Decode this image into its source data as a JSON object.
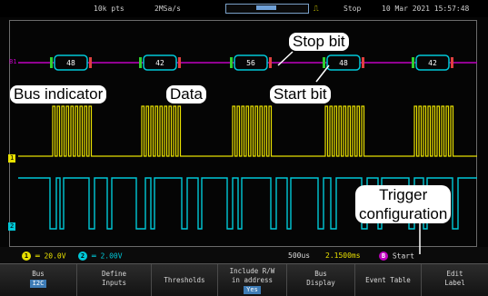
{
  "status": {
    "sample_points": "10k pts",
    "sample_rate": "2MSa/s",
    "trigger_state": "Stop",
    "datetime": "10 Mar 2021 15:57:48",
    "trigger_edge_icon": "rising-edge-icon"
  },
  "bus": {
    "marker": "B1",
    "packets": [
      "48",
      "42",
      "56",
      "48",
      "42"
    ],
    "color": "#c000c0"
  },
  "channels": {
    "ch1_marker": "1",
    "ch2_marker": "2",
    "ch1_color": "#e8e000",
    "ch2_color": "#00c8d8"
  },
  "channel_bar": {
    "ch1_label": "1",
    "ch1_scale": "20.0V",
    "ch2_label": "2",
    "ch2_scale": "2.00V",
    "timebase": "500us",
    "offset": "2.1500ms",
    "bus_label": "B",
    "trigger": "Start"
  },
  "softkeys": [
    {
      "label": "Bus",
      "value": "I2C"
    },
    {
      "label": "Define\nInputs"
    },
    {
      "label": "Thresholds"
    },
    {
      "label": "Include R/W\nin address",
      "value": "Yes"
    },
    {
      "label": "Bus\nDisplay"
    },
    {
      "label": "Event Table"
    },
    {
      "label": "Edit\nLabel"
    }
  ],
  "callouts": {
    "stop_bit": "Stop bit",
    "bus_indicator": "Bus indicator",
    "data": "Data",
    "start_bit": "Start bit",
    "trigger_line1": "Trigger",
    "trigger_line2": "configuration"
  }
}
